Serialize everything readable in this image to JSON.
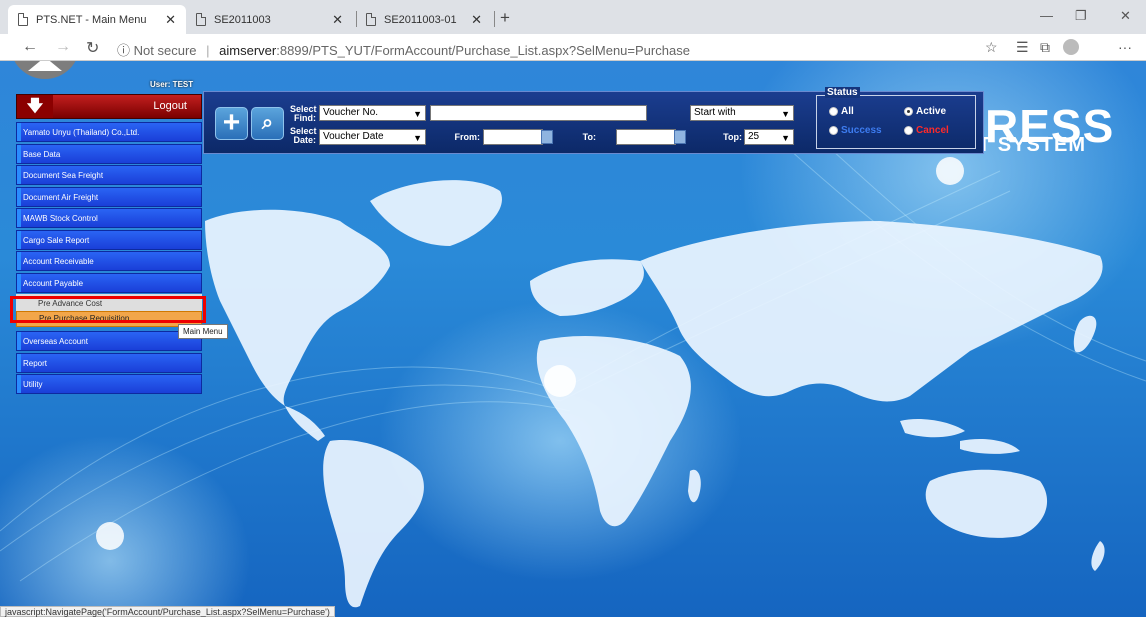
{
  "browser": {
    "tabs": [
      {
        "title": "PTS.NET - Main Menu",
        "active": true
      },
      {
        "title": "SE2011003",
        "active": false
      },
      {
        "title": "SE2011003-01",
        "active": false
      }
    ],
    "address": {
      "security": "Not secure",
      "host": "aimserver",
      "path": ":8899/PTS_YUT/FormAccount/Purchase_List.aspx?SelMenu=Purchase"
    },
    "status_url": "javascript:NavigatePage('FormAccount/Purchase_List.aspx?SelMenu=Purchase')"
  },
  "header": {
    "user": "User: TEST",
    "logout": "Logout",
    "brand": "RESS",
    "brand_sub": "T SYSTEM"
  },
  "menu": {
    "items_top": [
      "Yamato Unyu (Thailand) Co.,Ltd.",
      "Base Data",
      "Document Sea Freight",
      "Document Air Freight",
      "MAWB Stock Control",
      "Cargo Sale Report",
      "Account Receivable",
      "Account Payable"
    ],
    "submenu": [
      "Pre Advance Cost",
      "Pre Purchase Requisition"
    ],
    "items_bottom": [
      "Overseas Account",
      "Report",
      "Utility"
    ],
    "tooltip": "Main Menu"
  },
  "search": {
    "select_find_label": "Select Find:",
    "select_date_label": "Select Date:",
    "find_field": "Voucher No.",
    "match_mode": "Start with",
    "date_field": "Voucher Date",
    "from_label": "From:",
    "to_label": "To:",
    "top_label": "Top:",
    "top_value": "25",
    "status_title": "Status",
    "status_options": {
      "all": "All",
      "active": "Active",
      "success": "Success",
      "cancel": "Cancel"
    },
    "status_selected": "Active"
  },
  "colors": {
    "menu_blue": "#1a3fd8",
    "highlight": "#f2a64a",
    "cancel_red": "#e00000",
    "success_blue": "#1e5bd0"
  }
}
